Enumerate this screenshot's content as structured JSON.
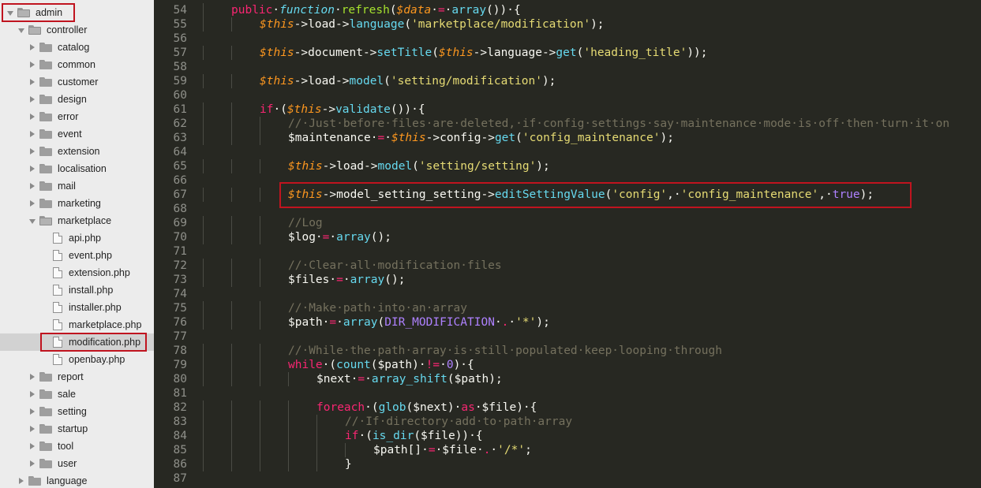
{
  "sidebar": {
    "tree": [
      {
        "label": "admin",
        "type": "folder",
        "depth": 0,
        "expanded": true
      },
      {
        "label": "controller",
        "type": "folder",
        "depth": 1,
        "expanded": true
      },
      {
        "label": "catalog",
        "type": "folder",
        "depth": 2,
        "expanded": false
      },
      {
        "label": "common",
        "type": "folder",
        "depth": 2,
        "expanded": false
      },
      {
        "label": "customer",
        "type": "folder",
        "depth": 2,
        "expanded": false
      },
      {
        "label": "design",
        "type": "folder",
        "depth": 2,
        "expanded": false
      },
      {
        "label": "error",
        "type": "folder",
        "depth": 2,
        "expanded": false
      },
      {
        "label": "event",
        "type": "folder",
        "depth": 2,
        "expanded": false
      },
      {
        "label": "extension",
        "type": "folder",
        "depth": 2,
        "expanded": false
      },
      {
        "label": "localisation",
        "type": "folder",
        "depth": 2,
        "expanded": false
      },
      {
        "label": "mail",
        "type": "folder",
        "depth": 2,
        "expanded": false
      },
      {
        "label": "marketing",
        "type": "folder",
        "depth": 2,
        "expanded": false
      },
      {
        "label": "marketplace",
        "type": "folder",
        "depth": 2,
        "expanded": true
      },
      {
        "label": "api.php",
        "type": "file",
        "depth": 3
      },
      {
        "label": "event.php",
        "type": "file",
        "depth": 3
      },
      {
        "label": "extension.php",
        "type": "file",
        "depth": 3
      },
      {
        "label": "install.php",
        "type": "file",
        "depth": 3
      },
      {
        "label": "installer.php",
        "type": "file",
        "depth": 3
      },
      {
        "label": "marketplace.php",
        "type": "file",
        "depth": 3
      },
      {
        "label": "modification.php",
        "type": "file",
        "depth": 3,
        "selected": true
      },
      {
        "label": "openbay.php",
        "type": "file",
        "depth": 3
      },
      {
        "label": "report",
        "type": "folder",
        "depth": 2,
        "expanded": false
      },
      {
        "label": "sale",
        "type": "folder",
        "depth": 2,
        "expanded": false
      },
      {
        "label": "setting",
        "type": "folder",
        "depth": 2,
        "expanded": false
      },
      {
        "label": "startup",
        "type": "folder",
        "depth": 2,
        "expanded": false
      },
      {
        "label": "tool",
        "type": "folder",
        "depth": 2,
        "expanded": false
      },
      {
        "label": "user",
        "type": "folder",
        "depth": 2,
        "expanded": false
      },
      {
        "label": "language",
        "type": "folder",
        "depth": 1,
        "expanded": false
      }
    ]
  },
  "editor": {
    "lines": [
      {
        "num": "54",
        "indent": 1,
        "tokens": [
          [
            "kw",
            "public"
          ],
          [
            "",
            "·"
          ],
          [
            "sto",
            "function"
          ],
          [
            "",
            "·"
          ],
          [
            "fn",
            "refresh"
          ],
          [
            "",
            "("
          ],
          [
            "var",
            "$data"
          ],
          [
            "",
            "·"
          ],
          [
            "kw",
            "="
          ],
          [
            "",
            "·"
          ],
          [
            "sup",
            "array"
          ],
          [
            "",
            "())·{"
          ]
        ]
      },
      {
        "num": "55",
        "indent": 2,
        "tokens": [
          [
            "var",
            "$this"
          ],
          [
            "",
            "->load->"
          ],
          [
            "sup",
            "language"
          ],
          [
            "",
            "("
          ],
          [
            "str",
            "'marketplace/modification'"
          ],
          [
            "",
            ");"
          ]
        ]
      },
      {
        "num": "56",
        "indent": 0,
        "tokens": []
      },
      {
        "num": "57",
        "indent": 2,
        "tokens": [
          [
            "var",
            "$this"
          ],
          [
            "",
            "->document->"
          ],
          [
            "sup",
            "setTitle"
          ],
          [
            "",
            "("
          ],
          [
            "var",
            "$this"
          ],
          [
            "",
            "->language->"
          ],
          [
            "sup",
            "get"
          ],
          [
            "",
            "("
          ],
          [
            "str",
            "'heading_title'"
          ],
          [
            "",
            "));"
          ]
        ]
      },
      {
        "num": "58",
        "indent": 0,
        "tokens": []
      },
      {
        "num": "59",
        "indent": 2,
        "tokens": [
          [
            "var",
            "$this"
          ],
          [
            "",
            "->load->"
          ],
          [
            "sup",
            "model"
          ],
          [
            "",
            "("
          ],
          [
            "str",
            "'setting/modification'"
          ],
          [
            "",
            ");"
          ]
        ]
      },
      {
        "num": "60",
        "indent": 0,
        "tokens": []
      },
      {
        "num": "61",
        "indent": 2,
        "tokens": [
          [
            "kw",
            "if"
          ],
          [
            "",
            "·("
          ],
          [
            "var",
            "$this"
          ],
          [
            "",
            "->"
          ],
          [
            "sup",
            "validate"
          ],
          [
            "",
            "())·{"
          ]
        ]
      },
      {
        "num": "62",
        "indent": 3,
        "tokens": [
          [
            "cmt",
            "//·Just·before·files·are·deleted,·if·config·settings·say·maintenance·mode·is·off·then·turn·it·on"
          ]
        ]
      },
      {
        "num": "63",
        "indent": 3,
        "tokens": [
          [
            "",
            "$maintenance·"
          ],
          [
            "kw",
            "="
          ],
          [
            "",
            "·"
          ],
          [
            "var",
            "$this"
          ],
          [
            "",
            "->config->"
          ],
          [
            "sup",
            "get"
          ],
          [
            "",
            "("
          ],
          [
            "str",
            "'config_maintenance'"
          ],
          [
            "",
            ");"
          ]
        ]
      },
      {
        "num": "64",
        "indent": 0,
        "tokens": []
      },
      {
        "num": "65",
        "indent": 3,
        "tokens": [
          [
            "var",
            "$this"
          ],
          [
            "",
            "->load->"
          ],
          [
            "sup",
            "model"
          ],
          [
            "",
            "("
          ],
          [
            "str",
            "'setting/setting'"
          ],
          [
            "",
            ");"
          ]
        ]
      },
      {
        "num": "66",
        "indent": 0,
        "tokens": []
      },
      {
        "num": "67",
        "indent": 3,
        "tokens": [
          [
            "var",
            "$this"
          ],
          [
            "",
            "->model_setting_setting->"
          ],
          [
            "sup",
            "editSettingValue"
          ],
          [
            "",
            "("
          ],
          [
            "str",
            "'config'"
          ],
          [
            "",
            ",·"
          ],
          [
            "str",
            "'config_maintenance'"
          ],
          [
            "",
            ",·"
          ],
          [
            "const",
            "true"
          ],
          [
            "",
            ");"
          ]
        ]
      },
      {
        "num": "68",
        "indent": 0,
        "tokens": []
      },
      {
        "num": "69",
        "indent": 3,
        "tokens": [
          [
            "cmt",
            "//Log"
          ]
        ]
      },
      {
        "num": "70",
        "indent": 3,
        "tokens": [
          [
            "",
            "$log·"
          ],
          [
            "kw",
            "="
          ],
          [
            "",
            "·"
          ],
          [
            "sup",
            "array"
          ],
          [
            "",
            "();"
          ]
        ]
      },
      {
        "num": "71",
        "indent": 0,
        "tokens": []
      },
      {
        "num": "72",
        "indent": 3,
        "tokens": [
          [
            "cmt",
            "//·Clear·all·modification·files"
          ]
        ]
      },
      {
        "num": "73",
        "indent": 3,
        "tokens": [
          [
            "",
            "$files·"
          ],
          [
            "kw",
            "="
          ],
          [
            "",
            "·"
          ],
          [
            "sup",
            "array"
          ],
          [
            "",
            "();"
          ]
        ]
      },
      {
        "num": "74",
        "indent": 0,
        "tokens": []
      },
      {
        "num": "75",
        "indent": 3,
        "tokens": [
          [
            "cmt",
            "//·Make·path·into·an·array"
          ]
        ]
      },
      {
        "num": "76",
        "indent": 3,
        "tokens": [
          [
            "",
            "$path·"
          ],
          [
            "kw",
            "="
          ],
          [
            "",
            "·"
          ],
          [
            "sup",
            "array"
          ],
          [
            "",
            "("
          ],
          [
            "const",
            "DIR_MODIFICATION"
          ],
          [
            "",
            "·"
          ],
          [
            "kw",
            "."
          ],
          [
            "",
            "·"
          ],
          [
            "str",
            "'*'"
          ],
          [
            "",
            ");"
          ]
        ]
      },
      {
        "num": "77",
        "indent": 0,
        "tokens": []
      },
      {
        "num": "78",
        "indent": 3,
        "tokens": [
          [
            "cmt",
            "//·While·the·path·array·is·still·populated·keep·looping·through"
          ]
        ]
      },
      {
        "num": "79",
        "indent": 3,
        "tokens": [
          [
            "kw",
            "while"
          ],
          [
            "",
            "·("
          ],
          [
            "sup",
            "count"
          ],
          [
            "",
            "($path)·"
          ],
          [
            "kw",
            "!="
          ],
          [
            "",
            "·"
          ],
          [
            "const",
            "0"
          ],
          [
            "",
            ")·{"
          ]
        ]
      },
      {
        "num": "80",
        "indent": 4,
        "tokens": [
          [
            "",
            "$next·"
          ],
          [
            "kw",
            "="
          ],
          [
            "",
            "·"
          ],
          [
            "sup",
            "array_shift"
          ],
          [
            "",
            "($path);"
          ]
        ]
      },
      {
        "num": "81",
        "indent": 0,
        "tokens": []
      },
      {
        "num": "82",
        "indent": 4,
        "tokens": [
          [
            "kw",
            "foreach"
          ],
          [
            "",
            "·("
          ],
          [
            "sup",
            "glob"
          ],
          [
            "",
            "($next)·"
          ],
          [
            "kw",
            "as"
          ],
          [
            "",
            "·$file)·{"
          ]
        ]
      },
      {
        "num": "83",
        "indent": 5,
        "tokens": [
          [
            "cmt",
            "//·If·directory·add·to·path·array"
          ]
        ]
      },
      {
        "num": "84",
        "indent": 5,
        "tokens": [
          [
            "kw",
            "if"
          ],
          [
            "",
            "·("
          ],
          [
            "sup",
            "is_dir"
          ],
          [
            "",
            "($file))·{"
          ]
        ]
      },
      {
        "num": "85",
        "indent": 6,
        "tokens": [
          [
            "",
            "$path[]·"
          ],
          [
            "kw",
            "="
          ],
          [
            "",
            "·$file·"
          ],
          [
            "kw",
            "."
          ],
          [
            "",
            "·"
          ],
          [
            "str",
            "'/*'"
          ],
          [
            "",
            ";"
          ]
        ]
      },
      {
        "num": "86",
        "indent": 5,
        "tokens": [
          [
            "",
            "}"
          ]
        ]
      },
      {
        "num": "87",
        "indent": 0,
        "tokens": []
      }
    ]
  }
}
